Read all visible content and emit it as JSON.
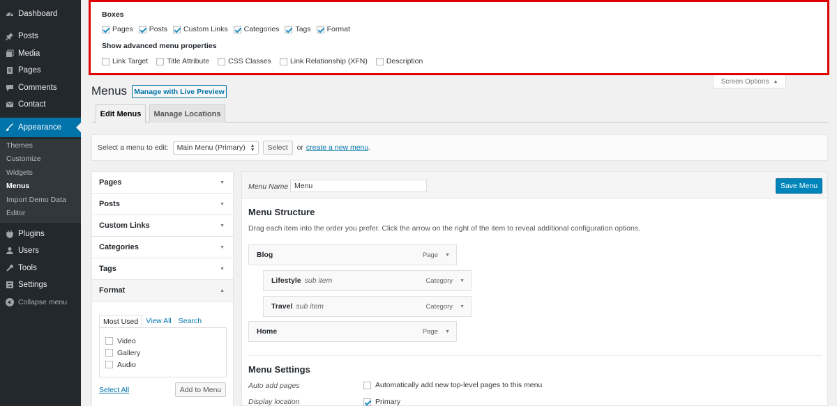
{
  "sidebar": {
    "top_items": [
      {
        "label": "Dashboard",
        "icon": "dashboard-icon"
      },
      {
        "label": "Posts",
        "icon": "pin-icon"
      },
      {
        "label": "Media",
        "icon": "media-icon"
      },
      {
        "label": "Pages",
        "icon": "pages-icon"
      },
      {
        "label": "Comments",
        "icon": "comments-icon"
      },
      {
        "label": "Contact",
        "icon": "mail-icon"
      }
    ],
    "active_item": {
      "label": "Appearance",
      "icon": "brush-icon"
    },
    "sub_items": [
      "Themes",
      "Customize",
      "Widgets",
      "Menus",
      "Import Demo Data",
      "Editor"
    ],
    "current_sub": "Menus",
    "bottom_items": [
      {
        "label": "Plugins",
        "icon": "plugin-icon"
      },
      {
        "label": "Users",
        "icon": "users-icon"
      },
      {
        "label": "Tools",
        "icon": "tools-icon"
      },
      {
        "label": "Settings",
        "icon": "settings-icon"
      }
    ],
    "collapse_label": "Collapse menu"
  },
  "screen_options": {
    "boxes_heading": "Boxes",
    "boxes": [
      {
        "label": "Pages",
        "checked": true
      },
      {
        "label": "Posts",
        "checked": true
      },
      {
        "label": "Custom Links",
        "checked": true
      },
      {
        "label": "Categories",
        "checked": true
      },
      {
        "label": "Tags",
        "checked": true
      },
      {
        "label": "Format",
        "checked": true
      }
    ],
    "advanced_heading": "Show advanced menu properties",
    "advanced": [
      {
        "label": "Link Target",
        "checked": false
      },
      {
        "label": "Title Attribute",
        "checked": false
      },
      {
        "label": "CSS Classes",
        "checked": false
      },
      {
        "label": "Link Relationship (XFN)",
        "checked": false
      },
      {
        "label": "Description",
        "checked": false
      }
    ],
    "tab_label": "Screen Options",
    "highlight_color": "#e00000"
  },
  "header": {
    "title": "Menus",
    "live_preview": "Manage with Live Preview",
    "tabs": [
      "Edit Menus",
      "Manage Locations"
    ]
  },
  "manage_bar": {
    "label": "Select a menu to edit:",
    "selected_menu": "Main Menu (Primary)",
    "select_button": "Select",
    "or_text": "or",
    "create_link": "create a new menu",
    "period": "."
  },
  "accordion": {
    "sections": [
      "Pages",
      "Posts",
      "Custom Links",
      "Categories",
      "Tags",
      "Format"
    ],
    "open_section": "Format",
    "sub_tabs": [
      "Most Used",
      "View All",
      "Search"
    ],
    "items": [
      "Video",
      "Gallery",
      "Audio"
    ],
    "select_all": "Select All",
    "add_button": "Add to Menu"
  },
  "menu": {
    "name_label": "Menu Name",
    "name_value": "Menu",
    "save_button": "Save Menu",
    "structure_title": "Menu Structure",
    "structure_desc": "Drag each item into the order you prefer. Click the arrow on the right of the item to reveal additional configuration options.",
    "items": [
      {
        "title": "Blog",
        "sub": "",
        "type": "Page"
      },
      {
        "title": "Lifestyle",
        "sub": "sub item",
        "type": "Category"
      },
      {
        "title": "Travel",
        "sub": "sub item",
        "type": "Category"
      },
      {
        "title": "Home",
        "sub": "",
        "type": "Page"
      }
    ],
    "settings_title": "Menu Settings",
    "auto_add_label": "Auto add pages",
    "auto_add_text": "Automatically add new top-level pages to this menu",
    "location_label": "Display location",
    "location_text": "Primary"
  },
  "colors": {
    "sidebar_bg": "#23282d",
    "accent": "#0073aa",
    "save_button": "#0085ba"
  }
}
